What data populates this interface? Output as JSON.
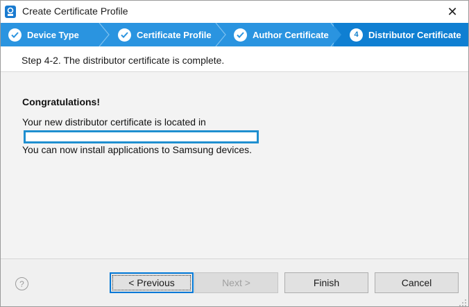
{
  "window": {
    "title": "Create Certificate Profile",
    "close_glyph": "✕"
  },
  "steps": [
    {
      "label": "Device Type",
      "status": "done",
      "icon": "check-icon"
    },
    {
      "label": "Certificate Profile",
      "status": "done",
      "icon": "check-icon"
    },
    {
      "label": "Author Certificate",
      "status": "done",
      "icon": "check-icon"
    },
    {
      "label": "Distributor Certificate",
      "status": "current",
      "number": "4"
    }
  ],
  "header": {
    "text": "Step 4-2. The distributor certificate is complete."
  },
  "content": {
    "heading": "Congratulations!",
    "line1": "Your new distributor certificate is located in",
    "line2": "You can now install applications to Samsung devices."
  },
  "footer": {
    "help_glyph": "?",
    "back_label": "< Previous",
    "next_label": "Next >",
    "finish_label": "Finish",
    "cancel_label": "Cancel"
  },
  "colors": {
    "stepbar": "#2a94e0",
    "stepbar_active": "#0f7fd2",
    "focus_border": "#0078d7"
  }
}
